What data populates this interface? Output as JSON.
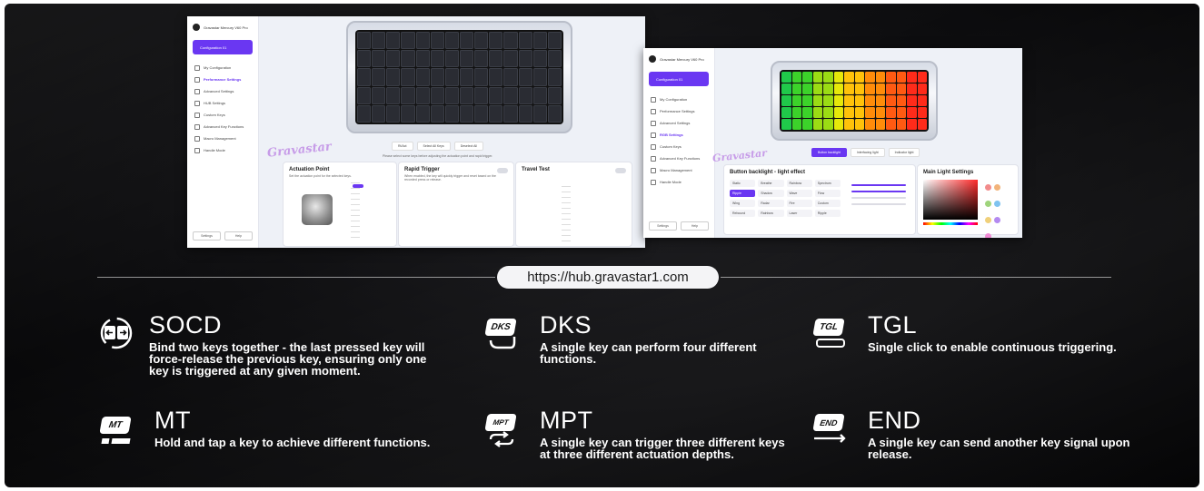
{
  "url": "https://hub.gravastar1.com",
  "screens": {
    "performance": {
      "device": "Gravastar Mercury V60 Pro",
      "config": "Configuration 01",
      "nav": [
        "My Configuration",
        "Performance Settings",
        "Advanced Settings",
        "HUB Settings",
        "Custom Keys",
        "Advanced Key Functions",
        "Macro Management",
        "Handle Mode"
      ],
      "footer": [
        "Settings",
        "Help"
      ],
      "tabs": [
        "Rt/Act",
        "Select All Keys",
        "Deselect All"
      ],
      "hint": "Please select some keys before adjusting the actuation point and rapid trigger.",
      "actuation_title": "Actuation Point",
      "actuation_desc": "Set the actuation point for the selected keys.",
      "rapid_title": "Rapid Trigger",
      "rapid_desc": "When enabled, the key will quickly trigger and reset based on the recorded press or release.",
      "travel_title": "Travel Test",
      "graffiti": "Gravastar"
    },
    "rgb": {
      "device": "Gravastar Mercury V60 Pro",
      "config": "Configuration 01",
      "nav": [
        "My Configuration",
        "Performance Settings",
        "Advanced Settings",
        "RGB Settings",
        "Custom Keys",
        "Advanced Key Functions",
        "Macro Management",
        "Handle Mode"
      ],
      "footer": [
        "Settings",
        "Help"
      ],
      "tabs": [
        "Button backlight",
        "Interfacing light",
        "Indicator light"
      ],
      "backlight_title": "Button backlight - light effect",
      "main_light_title": "Main Light Settings",
      "effects": [
        "Static",
        "Breathe",
        "Rainbow",
        "Spectrum",
        "Ripple",
        "Shadow",
        "Wave",
        "Flow",
        "Wing",
        "Radar",
        "Fire",
        "Custom",
        "Rebound",
        "Rainbow",
        "Laser",
        "Ripple"
      ],
      "graffiti": "Gravastar"
    }
  },
  "features": [
    {
      "icon": "socd",
      "icon_label": "",
      "title": "SOCD",
      "desc": [
        "Bind two keys together - the last pressed key will",
        "force-release the previous key, ensuring only one",
        "key is triggered at any given moment."
      ]
    },
    {
      "icon": "dks",
      "icon_label": "DKS",
      "title": "DKS",
      "desc": [
        "A single key can perform four different",
        "functions."
      ]
    },
    {
      "icon": "tgl",
      "icon_label": "TGL",
      "title": "TGL",
      "desc": [
        "Single click to enable continuous triggering."
      ]
    },
    {
      "icon": "mt",
      "icon_label": "MT",
      "title": "MT",
      "desc": [
        "Hold and tap a key to achieve different functions."
      ]
    },
    {
      "icon": "mpt",
      "icon_label": "MPT",
      "title": "MPT",
      "desc": [
        "A single key can trigger three different keys",
        "at three different actuation depths."
      ]
    },
    {
      "icon": "end",
      "icon_label": "END",
      "title": "END",
      "desc": [
        "A single key can send another key signal upon",
        "release."
      ]
    }
  ],
  "colors": {
    "accent": "#6a37f2",
    "background": "#0d0d0f",
    "text": "#ffffff"
  }
}
